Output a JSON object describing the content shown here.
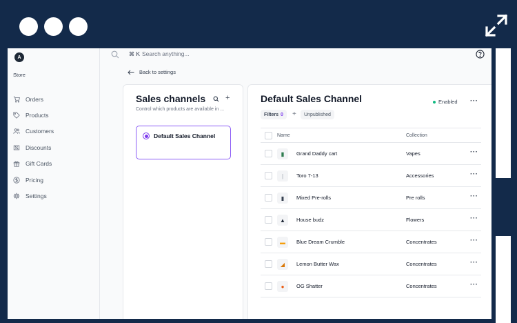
{
  "window": {
    "dots": 3,
    "expand_icon": "expand-arrows-icon"
  },
  "store": {
    "avatar": "A",
    "label": "Store"
  },
  "sidebar": {
    "items": [
      {
        "label": "Orders",
        "icon": "cart-icon"
      },
      {
        "label": "Products",
        "icon": "tag-icon"
      },
      {
        "label": "Customers",
        "icon": "users-icon"
      },
      {
        "label": "Discounts",
        "icon": "discount-icon"
      },
      {
        "label": "Gift Cards",
        "icon": "gift-icon"
      },
      {
        "label": "Pricing",
        "icon": "dollar-icon"
      },
      {
        "label": "Settings",
        "icon": "gear-icon"
      }
    ]
  },
  "search": {
    "shortcut": "⌘ K",
    "placeholder": "Search anything..."
  },
  "back_link": "Back to settings",
  "sales_channels": {
    "title": "Sales channels",
    "subtitle": "Control which products are available in ...",
    "channels": [
      {
        "name": "Default Sales Channel",
        "selected": true
      }
    ]
  },
  "detail": {
    "title": "Default Sales Channel",
    "status": "Enabled",
    "status_color": "#10b981",
    "filters": {
      "label": "Filters",
      "count": "0"
    },
    "chip": "Unpublished",
    "columns": {
      "name": "Name",
      "collection": "Collection"
    },
    "rows": [
      {
        "name": "Grand Daddy cart",
        "collection": "Vapes"
      },
      {
        "name": "Toro 7-13",
        "collection": "Accessories"
      },
      {
        "name": "Mixed Pre-rolls",
        "collection": "Pre rolls"
      },
      {
        "name": "House budz",
        "collection": "Flowers"
      },
      {
        "name": "Blue Dream Crumble",
        "collection": "Concentrates"
      },
      {
        "name": "Lemon Butter Wax",
        "collection": "Concentrates"
      },
      {
        "name": "OG Shatter",
        "collection": "Concentrates"
      }
    ]
  },
  "accent_color": "#7c3aed"
}
